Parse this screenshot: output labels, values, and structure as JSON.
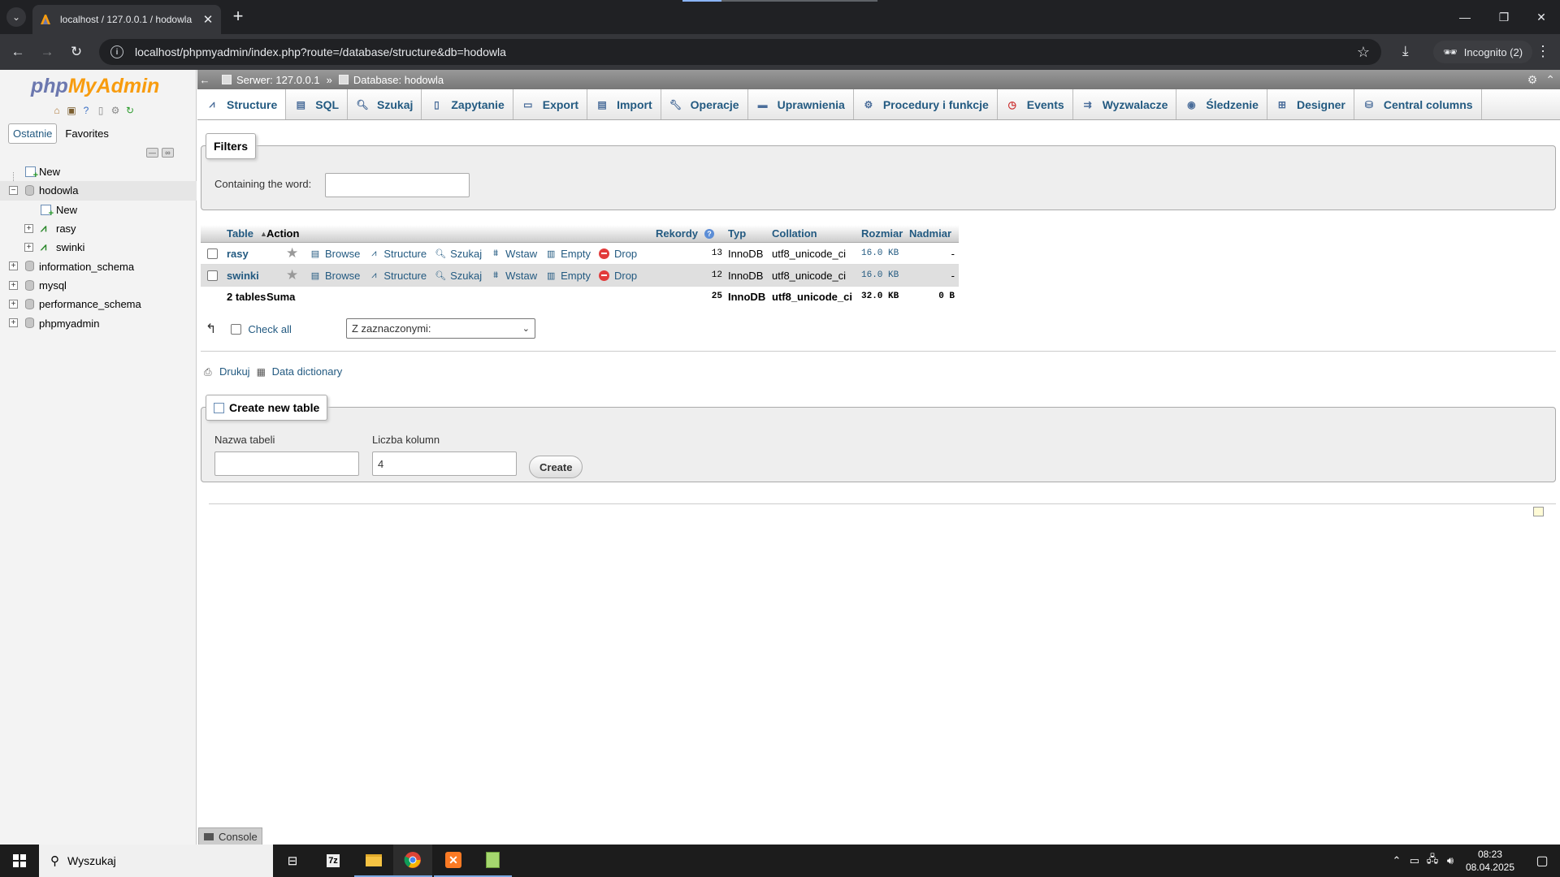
{
  "browser": {
    "tab_title": "localhost / 127.0.0.1 / hodowla",
    "url": "localhost/phpmyadmin/index.php?route=/database/structure&db=hodowla",
    "incognito_label": "Incognito (2)"
  },
  "nav": {
    "logo_php": "php",
    "logo_myadmin": "MyAdmin",
    "tabs": [
      "Ostatnie",
      "Favorites"
    ],
    "tree": {
      "new_root": "New",
      "current_db": "hodowla",
      "db_new": "New",
      "tables": [
        "rasy",
        "swinki"
      ],
      "other_dbs": [
        "information_schema",
        "mysql",
        "performance_schema",
        "phpmyadmin"
      ]
    }
  },
  "breadcrumb": {
    "server": "Serwer: 127.0.0.1",
    "separator": "»",
    "database": "Database: hodowla"
  },
  "tabs": [
    "Structure",
    "SQL",
    "Szukaj",
    "Zapytanie",
    "Export",
    "Import",
    "Operacje",
    "Uprawnienia",
    "Procedury i funkcje",
    "Events",
    "Wyzwalacze",
    "Śledzenie",
    "Designer",
    "Central columns"
  ],
  "filters": {
    "legend": "Filters",
    "label": "Containing the word:",
    "value": ""
  },
  "table": {
    "headers": [
      "Table",
      "Action",
      "Rekordy",
      "Typ",
      "Collation",
      "Rozmiar",
      "Nadmiar"
    ],
    "actions": [
      "Browse",
      "Structure",
      "Szukaj",
      "Wstaw",
      "Empty",
      "Drop"
    ],
    "rows": [
      {
        "name": "rasy",
        "rows": "13",
        "type": "InnoDB",
        "collation": "utf8_unicode_ci",
        "size": "16.0 KB",
        "overhead": "-"
      },
      {
        "name": "swinki",
        "rows": "12",
        "type": "InnoDB",
        "collation": "utf8_unicode_ci",
        "size": "16.0 KB",
        "overhead": "-"
      }
    ],
    "footer": {
      "count": "2 tables",
      "sum_label": "Suma",
      "rows": "25",
      "type": "InnoDB",
      "collation": "utf8_unicode_ci",
      "size": "32.0 KB",
      "overhead": "0 B"
    }
  },
  "bulk": {
    "check_all": "Check all",
    "select_value": "Z zaznaczonymi:"
  },
  "links": {
    "print": "Drukuj",
    "data_dictionary": "Data dictionary"
  },
  "create_table": {
    "legend": "Create new table",
    "name_label": "Nazwa tabeli",
    "name_value": "",
    "columns_label": "Liczba kolumn",
    "columns_value": "4",
    "button": "Create"
  },
  "console": {
    "label": "Console"
  },
  "taskbar": {
    "search_placeholder": "Wyszukaj",
    "time": "08:23",
    "date": "08.04.2025"
  }
}
